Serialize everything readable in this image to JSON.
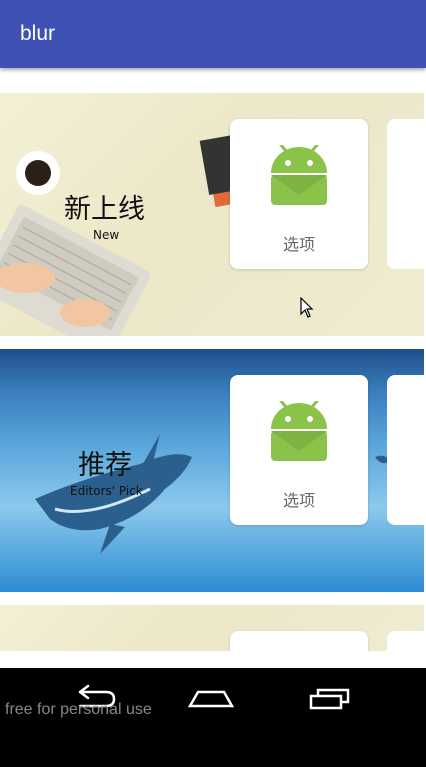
{
  "app": {
    "title": "blur"
  },
  "rows": [
    {
      "label_cn": "新上线",
      "label_en": "New",
      "card_caption": "选项"
    },
    {
      "label_cn": "推荐",
      "label_en": "Editors' Pick",
      "card_caption": "选项"
    }
  ],
  "watermark": "free for personal use",
  "colors": {
    "appbar": "#3f51b5",
    "android_green": "#8bc34a"
  }
}
